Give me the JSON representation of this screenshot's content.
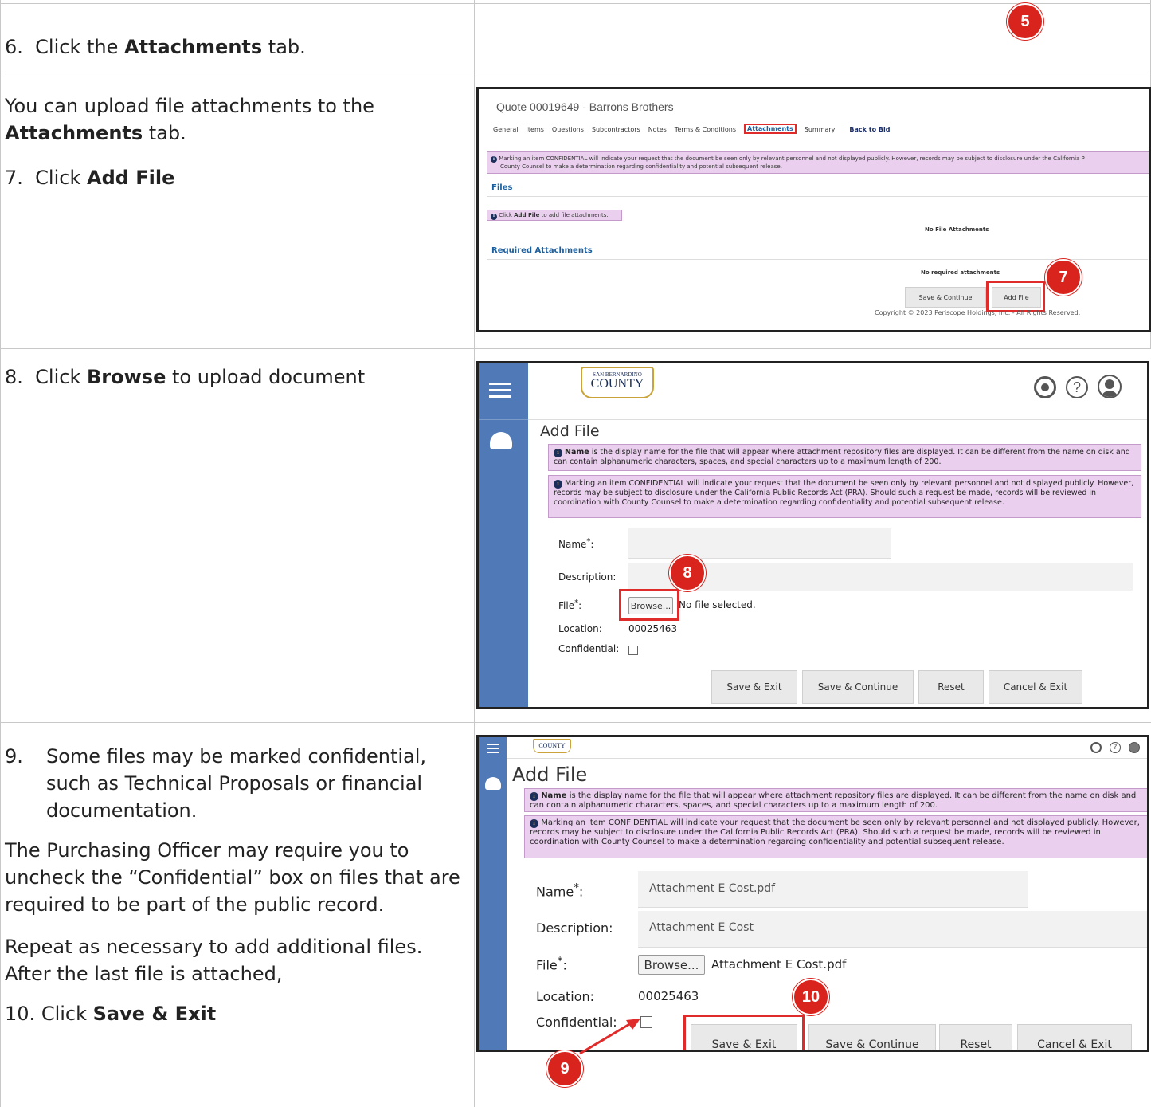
{
  "steps": {
    "s6": {
      "num": "6.",
      "pre": "Click the ",
      "bold": "Attachments",
      "post": " tab."
    },
    "s7_intro_pre": "You can upload file attachments to the ",
    "s7_intro_bold": "Attachments",
    "s7_intro_post": " tab.",
    "s7": {
      "num": "7.",
      "pre": "Click ",
      "bold": "Add File"
    },
    "s8": {
      "num": "8.",
      "pre": "Click ",
      "bold": "Browse",
      "post": " to upload document"
    },
    "s9": {
      "num": "9.",
      "text": "Some files may be marked confidential, such as Technical Proposals or financial documentation."
    },
    "p_officer": "The Purchasing Officer may require you to uncheck the “Confidential” box on files that are required to be part of the public record.",
    "p_repeat": "Repeat as necessary to add additional files. After the last file is attached,",
    "s10": {
      "num": "10.",
      "pre": "Click ",
      "bold": "Save & Exit"
    }
  },
  "badges": {
    "b5": "5",
    "b7": "7",
    "b8": "8",
    "b9": "9",
    "b10": "10"
  },
  "shot1": {
    "title": "Quote 00019649 - Barrons Brothers",
    "tabs": [
      "General",
      "Items",
      "Questions",
      "Subcontractors",
      "Notes",
      "Terms & Conditions",
      "Attachments",
      "Summary"
    ],
    "back": "Back to Bid",
    "notice": "Marking an item CONFIDENTIAL will indicate your request that the document be seen only by relevant personnel and not displayed publicly. However, records may be subject to disclosure under the California P",
    "notice2": "County Counsel to make a determination regarding confidentiality and potential subsequent release.",
    "files_heading": "Files",
    "hint_pre": "Click ",
    "hint_bold": "Add File",
    "hint_post": " to add file attachments.",
    "no_files": "No File Attachments",
    "req_heading": "Required Attachments",
    "no_required": "No required attachments",
    "btn_save_continue": "Save & Continue",
    "btn_add_file": "Add File",
    "copyright": "Copyright © 2023 Periscope Holdings, Inc. - All Rights Reserved."
  },
  "shot2": {
    "logo_top": "SAN BERNARDINO",
    "logo_main": "COUNTY",
    "title": "Add File",
    "info1_bold": "Name",
    "info1": " is the display name for the file that will appear where attachment repository files are displayed. It can be different from the name on disk and can contain alphanumeric characters, spaces, and special characters up to a maximum length of 200.",
    "info2": "Marking an item CONFIDENTIAL will indicate your request that the document be seen only by relevant personnel and not displayed publicly. However, records may be subject to disclosure under the California Public Records Act (PRA). Should such a request be made, records will be reviewed in coordination with County Counsel to make a determination regarding confidentiality and potential subsequent release.",
    "lbl_name": "Name",
    "lbl_desc": "Description:",
    "lbl_file": "File",
    "lbl_location": "Location:",
    "lbl_conf": "Confidential:",
    "name_value": "",
    "desc_value": "",
    "browse": "Browse...",
    "file_status": "No file selected.",
    "location": "00025463",
    "btn_save_exit": "Save & Exit",
    "btn_save_continue": "Save & Continue",
    "btn_reset": "Reset",
    "btn_cancel_exit": "Cancel & Exit"
  },
  "shot3": {
    "logo_main": "COUNTY",
    "title": "Add File",
    "info1_bold": "Name",
    "info1": " is the display name for the file that will appear where attachment repository files are displayed. It can be different from the name on disk and can contain alphanumeric characters, spaces, and special characters up to a maximum length of 200.",
    "info2": "Marking an item CONFIDENTIAL will indicate your request that the document be seen only by relevant personnel and not displayed publicly. However, records may be subject to disclosure under the California Public Records Act (PRA). Should such a request be made, records will be reviewed in coordination with County Counsel to make a determination regarding confidentiality and potential subsequent release.",
    "lbl_name": "Name",
    "lbl_desc": "Description:",
    "lbl_file": "File",
    "lbl_location": "Location:",
    "lbl_conf": "Confidential:",
    "name_value": "Attachment E Cost.pdf",
    "desc_value": "Attachment E Cost",
    "browse": "Browse...",
    "file_status": "Attachment E Cost.pdf",
    "location": "00025463",
    "btn_save_exit": "Save & Exit",
    "btn_save_continue": "Save & Continue",
    "btn_reset": "Reset",
    "btn_cancel_exit": "Cancel & Exit"
  },
  "colors": {
    "badge": "#d9231d",
    "sidebar": "#4f7ab7",
    "notice": "#ead0ee",
    "link": "#1c5f9f"
  }
}
